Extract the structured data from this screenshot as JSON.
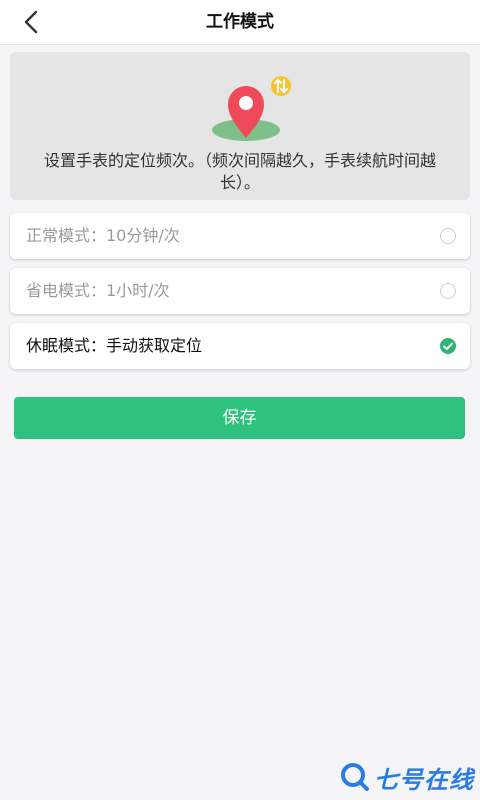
{
  "header": {
    "title": "工作模式"
  },
  "info": {
    "text": "设置手表的定位频次。（频次间隔越久，手表续航时间越长）。"
  },
  "options": [
    {
      "label": "正常模式：10分钟/次",
      "selected": false
    },
    {
      "label": "省电模式：1小时/次",
      "selected": false
    },
    {
      "label": "休眠模式：手动获取定位",
      "selected": true
    }
  ],
  "save_label": "保存",
  "watermark": {
    "text": "七号在线"
  },
  "colors": {
    "accent": "#2ec27e",
    "check": "#2bb673",
    "pin": "#ef4a5a",
    "watermark": "#2a7be4"
  }
}
